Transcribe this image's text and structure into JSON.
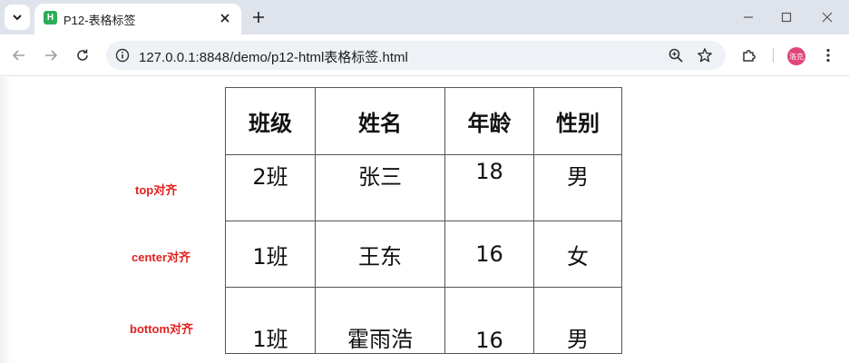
{
  "browser": {
    "tab": {
      "title": "P12-表格标签"
    },
    "favicon_letter": "H",
    "address": {
      "url": "127.0.0.1:8848/demo/p12-html表格标签.html"
    },
    "profile": {
      "avatar_text": "洛克"
    },
    "colors": {
      "tabstrip": "#dfe3eb",
      "omnibox": "#eef1f6",
      "favicon": "#2bae56",
      "avatar": "#e0457b"
    }
  },
  "page": {
    "notes": {
      "top": "top对齐",
      "center": "center对齐",
      "bottom": "bottom对齐",
      "color": "#e0211f"
    },
    "table": {
      "headers": [
        "班级",
        "姓名",
        "年龄",
        "性别"
      ],
      "rows": [
        [
          "2班",
          "张三",
          "18",
          "男"
        ],
        [
          "1班",
          "王东",
          "16",
          "女"
        ],
        [
          "1班",
          "霍雨浩",
          "16",
          "男"
        ]
      ]
    }
  }
}
